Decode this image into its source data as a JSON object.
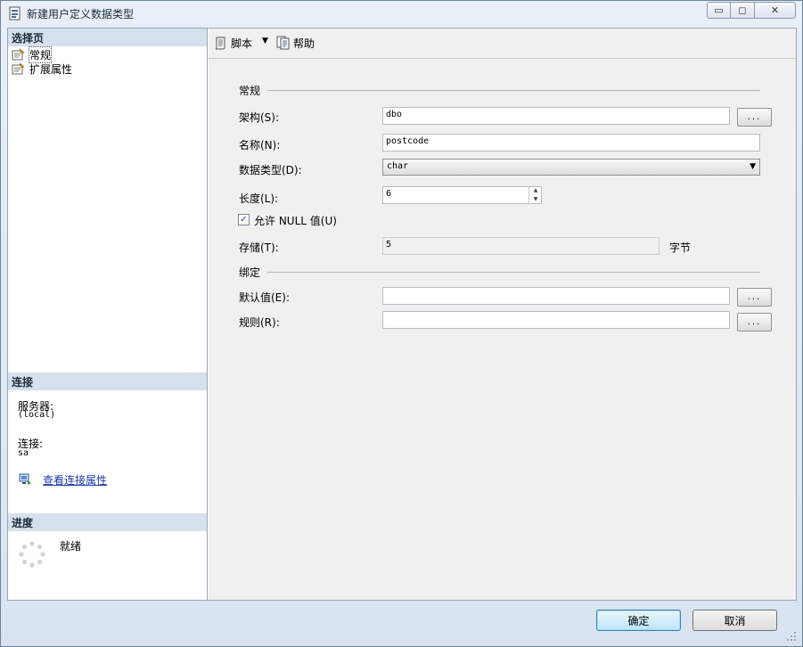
{
  "window": {
    "title": "新建用户定义数据类型",
    "minimize_label": "▭",
    "maximize_label": "◻",
    "close_label": "✕"
  },
  "left": {
    "select_page_header": "选择页",
    "pages": [
      {
        "label": "常规"
      },
      {
        "label": "扩展属性"
      }
    ],
    "connection_header": "连接",
    "server_label": "服务器:",
    "server_value": "(local)",
    "connection_label": "连接:",
    "connection_value": "sa",
    "view_connection_link": "查看连接属性",
    "progress_header": "进度",
    "progress_status": "就绪"
  },
  "toolbar": {
    "script_label": "脚本",
    "help_label": "帮助",
    "dropdown_glyph": "▼"
  },
  "form": {
    "general_section": "常规",
    "schema_label": "架构(S):",
    "schema_value": "dbo",
    "name_label": "名称(N):",
    "name_value": "postcode",
    "datatype_label": "数据类型(D):",
    "datatype_value": "char",
    "length_label": "长度(L):",
    "length_value": "6",
    "allow_null_label": "允许 NULL 值(U)",
    "allow_null_checked": "✓",
    "storage_label": "存储(T):",
    "storage_value": "5",
    "storage_unit": "字节",
    "binding_section": "绑定",
    "default_label": "默认值(E):",
    "default_value": "",
    "rule_label": "规则(R):",
    "rule_value": "",
    "ellipsis_label": "...",
    "select_arrow": "▼",
    "spin_up": "▲",
    "spin_down": "▼"
  },
  "footer": {
    "ok_label": "确定",
    "cancel_label": "取消"
  }
}
